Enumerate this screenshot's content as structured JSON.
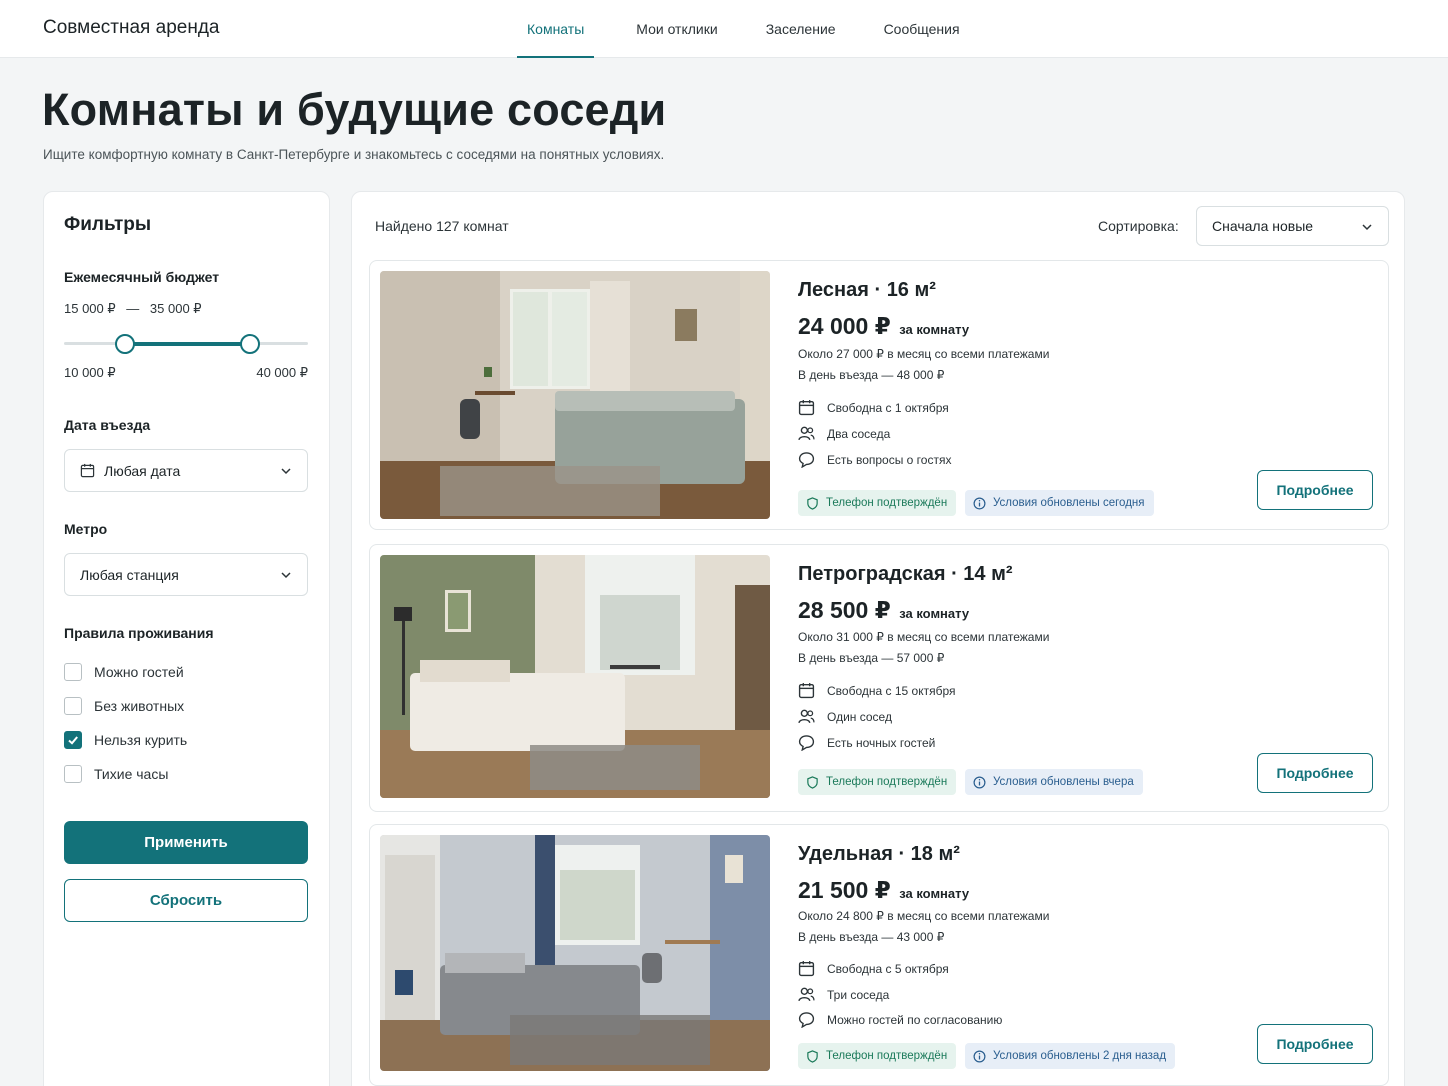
{
  "app": {
    "title": "Совместная аренда"
  },
  "nav": [
    {
      "label": "Комнаты",
      "active": true
    },
    {
      "label": "Мои отклики",
      "active": false
    },
    {
      "label": "Заселение",
      "active": false
    },
    {
      "label": "Сообщения",
      "active": false
    }
  ],
  "page": {
    "title": "Комнаты и будущие соседи",
    "subtitle": "Ищите комфортную комнату в Санкт-Петербурге и знакомьтесь с соседями на понятных условиях."
  },
  "filters": {
    "title": "Фильтры",
    "budget": {
      "label": "Ежемесячный бюджет",
      "from": "15 000 ₽",
      "separator": "—",
      "to": "35 000 ₽",
      "min": "10 000 ₽",
      "max": "40 000 ₽"
    },
    "move_in": {
      "label": "Дата въезда",
      "value": "Любая дата"
    },
    "metro": {
      "label": "Метро",
      "value": "Любая станция"
    },
    "rules": {
      "label": "Правила проживания",
      "options": [
        {
          "label": "Можно гостей",
          "checked": false
        },
        {
          "label": "Без животных",
          "checked": false
        },
        {
          "label": "Нельзя курить",
          "checked": true
        },
        {
          "label": "Тихие часы",
          "checked": false
        }
      ]
    },
    "apply_label": "Применить",
    "reset_label": "Сбросить"
  },
  "results": {
    "found": "Найдено 127 комнат",
    "sort_label": "Сортировка:",
    "sort_value": "Сначала новые",
    "listings": [
      {
        "metro": "Лесная",
        "dot": "·",
        "area": "16 м²",
        "price": "24 000 ₽",
        "price_unit": "за комнату",
        "total": "Около 27 000 ₽ в месяц со всеми платежами",
        "move_in_cost": "В день въезда — 48 000 ₽",
        "available": "Свободна с 1 октября",
        "neighbors": "Два соседа",
        "guests": "Есть вопросы о гостях",
        "tag_phone": "Телефон подтверждён",
        "tag_updated": "Условия обновлены сегодня",
        "details_label": "Подробнее"
      },
      {
        "metro": "Петроградская",
        "dot": "·",
        "area": "14 м²",
        "price": "28 500 ₽",
        "price_unit": "за комнату",
        "total": "Около 31 000 ₽ в месяц со всеми платежами",
        "move_in_cost": "В день въезда — 57 000 ₽",
        "available": "Свободна с 15 октября",
        "neighbors": "Один сосед",
        "guests": "Есть ночных гостей",
        "tag_phone": "Телефон подтверждён",
        "tag_updated": "Условия обновлены вчера",
        "details_label": "Подробнее"
      },
      {
        "metro": "Удельная",
        "dot": "·",
        "area": "18 м²",
        "price": "21 500 ₽",
        "price_unit": "за комнату",
        "total": "Около 24 800 ₽ в месяц со всеми платежами",
        "move_in_cost": "В день въезда — 43 000 ₽",
        "available": "Свободна с 5 октября",
        "neighbors": "Три соседа",
        "guests": "Можно гостей по согласованию",
        "tag_phone": "Телефон подтверждён",
        "tag_updated": "Условия обновлены 2 дня назад",
        "details_label": "Подробнее"
      }
    ]
  },
  "colors": {
    "accent": "#13727a",
    "background": "#f3f5f6",
    "tag_green_bg": "#e6f3ee",
    "tag_blue_bg": "#e7eef7"
  },
  "icons": [
    "calendar-icon",
    "people-icon",
    "chat-bubble-icon",
    "shield-icon",
    "info-icon",
    "chevron-down-icon",
    "check-icon"
  ]
}
